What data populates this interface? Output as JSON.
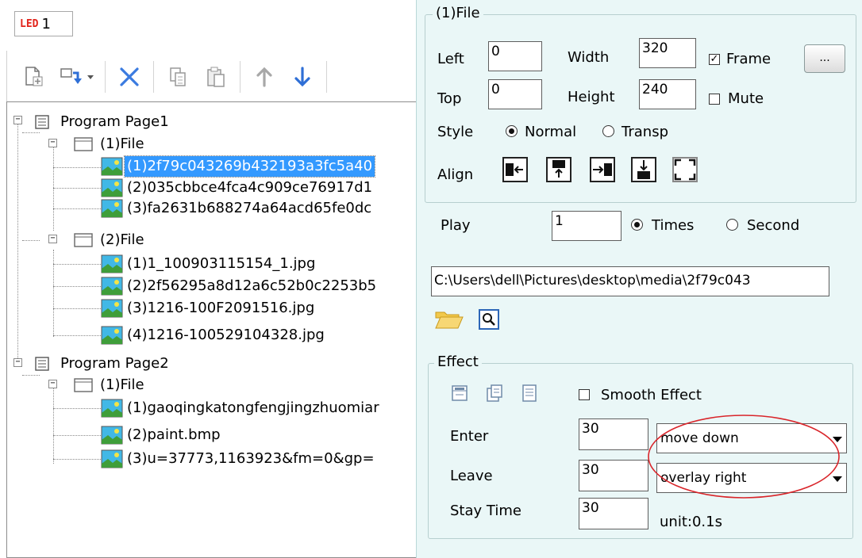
{
  "led_tab": {
    "badge": "LED",
    "number": "1"
  },
  "toolbar": {
    "icons": [
      "add-page-icon",
      "add-item-dropdown-icon",
      "delete-icon",
      "copy-icon",
      "paste-icon",
      "move-up-icon",
      "move-down-icon"
    ]
  },
  "tree": {
    "pages": [
      {
        "label": "Program Page1",
        "files": [
          {
            "label": "(1)File",
            "items": [
              "(1)2f79c043269b432193a3fc5a40",
              "(2)035cbbce4fca4c909ce76917d1",
              "(3)fa2631b688274a64acd65fe0dc"
            ]
          },
          {
            "label": "(2)File",
            "items": [
              "(1)1_100903115154_1.jpg",
              "(2)2f56295a8d12a6c52b0c2253b5",
              "(3)1216-100F2091516.jpg",
              "(4)1216-100529104328.jpg"
            ]
          }
        ]
      },
      {
        "label": "Program Page2",
        "files": [
          {
            "label": "(1)File",
            "items": [
              "(1)gaoqingkatongfengjingzhuomiar",
              "(2)paint.bmp",
              "(3)u=37773,1163923&fm=0&gp="
            ]
          }
        ]
      }
    ]
  },
  "props": {
    "group_title": "(1)File",
    "left_label": "Left",
    "left_value": "0",
    "top_label": "Top",
    "top_value": "0",
    "width_label": "Width",
    "width_value": "320",
    "height_label": "Height",
    "height_value": "240",
    "frame_label": "Frame",
    "frame_checked": true,
    "more_button": "...",
    "mute_label": "Mute",
    "mute_checked": false,
    "style_label": "Style",
    "style_normal": "Normal",
    "style_transp": "Transp",
    "align_label": "Align",
    "align_icons": [
      "align-left-icon",
      "align-top-icon",
      "align-right-icon",
      "align-bottom-icon",
      "align-fill-icon"
    ]
  },
  "play": {
    "label": "Play",
    "value": "1",
    "times_label": "Times",
    "second_label": "Second"
  },
  "path": {
    "value": "C:\\Users\\dell\\Pictures\\desktop\\media\\2f79c043",
    "icons": [
      "open-folder-icon",
      "preview-icon"
    ]
  },
  "effect": {
    "title": "Effect",
    "icons": [
      "effect-icon-1",
      "effect-icon-2",
      "effect-icon-3"
    ],
    "smooth_label": "Smooth Effect",
    "smooth_checked": false,
    "enter_label": "Enter",
    "enter_value": "30",
    "enter_effect": "move down",
    "leave_label": "Leave",
    "leave_value": "30",
    "leave_effect": "overlay right",
    "stay_label": "Stay Time",
    "stay_value": "30",
    "unit_label": "unit:0.1s"
  },
  "colors": {
    "panel_bg": "#eaf7f7",
    "selection": "#3399ff",
    "accent_icon": "#2f6fd6",
    "annotation_ring": "#d9252a"
  }
}
